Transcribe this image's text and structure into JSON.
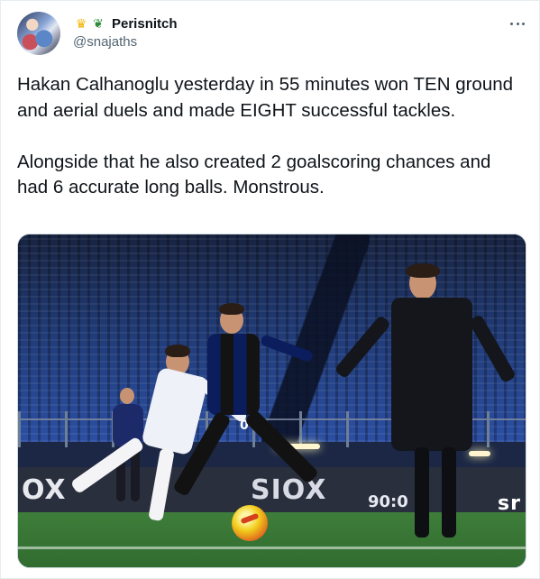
{
  "author": {
    "display_name": "Perisnitch",
    "handle": "@snajaths",
    "badges": [
      "crown-emoji-icon",
      "dragon-emoji-icon"
    ],
    "avatar_icon": "avatar-image"
  },
  "more_icon": "more-horizontal-icon",
  "tweet": {
    "text": "Hakan Calhanoglu yesterday in 55 minutes won TEN ground and aerial duels and made EIGHT successful tackles.\n\nAlongside that he also created 2 goalscoring chances and had 6 accurate long balls. Monstrous."
  },
  "media": {
    "ad_text_left": "OX",
    "ad_text_mid": "SIOX",
    "ad_score": "90:0",
    "ad_text_right": "sr",
    "player_number": "0"
  },
  "colors": {
    "text_primary": "#0f1419",
    "text_secondary": "#536471",
    "border": "#cfd9de"
  }
}
